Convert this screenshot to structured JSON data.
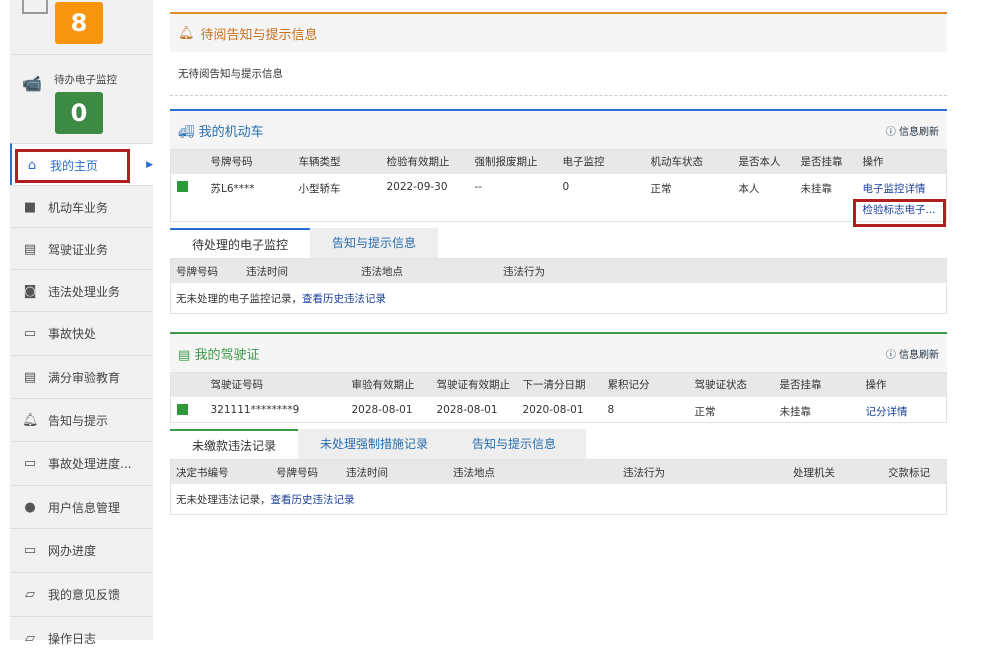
{
  "sidebar": {
    "pending_count": "8",
    "monitor_label": "待办电子监控",
    "monitor_count": "0",
    "items": [
      {
        "label": "我的主页",
        "icon": "home-icon"
      },
      {
        "label": "机动车业务",
        "icon": "truck-icon"
      },
      {
        "label": "驾驶证业务",
        "icon": "card-icon"
      },
      {
        "label": "违法处理业务",
        "icon": "camera-icon"
      },
      {
        "label": "事故快处",
        "icon": "car-icon"
      },
      {
        "label": "满分审验教育",
        "icon": "card-icon"
      },
      {
        "label": "告知与提示",
        "icon": "bell-icon"
      },
      {
        "label": "事故处理进度...",
        "icon": "car-icon"
      },
      {
        "label": "用户信息管理",
        "icon": "user-icon"
      },
      {
        "label": "网办进度",
        "icon": "car-icon"
      },
      {
        "label": "我的意见反馈",
        "icon": "feedback-icon"
      },
      {
        "label": "操作日志",
        "icon": "log-icon"
      }
    ]
  },
  "notice": {
    "title": "待阅告知与提示信息",
    "empty": "无待阅告知与提示信息"
  },
  "vehicle": {
    "title": "我的机动车",
    "refresh": "信息刷新",
    "headers": [
      "号牌号码",
      "车辆类型",
      "检验有效期止",
      "强制报废期止",
      "电子监控",
      "机动车状态",
      "是否本人",
      "是否挂靠",
      "操作"
    ],
    "row": [
      "苏L6****",
      "小型轿车",
      "2022-09-30",
      "--",
      "0",
      "正常",
      "本人",
      "未挂靠"
    ],
    "actions": [
      "电子监控详情",
      "检验标志电子..."
    ],
    "tabs": [
      "待处理的电子监控",
      "告知与提示信息"
    ],
    "sub_headers": [
      "号牌号码",
      "违法时间",
      "违法地点",
      "违法行为"
    ],
    "sub_msg": "无未处理的电子监控记录，",
    "sub_link": "查看历史违法记录"
  },
  "license": {
    "title": "我的驾驶证",
    "refresh": "信息刷新",
    "headers": [
      "驾驶证号码",
      "审验有效期止",
      "驾驶证有效期止",
      "下一清分日期",
      "累积记分",
      "驾驶证状态",
      "是否挂靠",
      "操作"
    ],
    "row": [
      "321111********9",
      "2028-08-01",
      "2028-08-01",
      "2020-08-01",
      "8",
      "正常",
      "未挂靠"
    ],
    "action": "记分详情",
    "tabs": [
      "未缴款违法记录",
      "未处理强制措施记录",
      "告知与提示信息"
    ],
    "sub_headers": [
      "决定书编号",
      "号牌号码",
      "违法时间",
      "违法地点",
      "违法行为",
      "处理机关",
      "交款标记"
    ],
    "sub_msg": "无未处理违法记录，",
    "sub_link": "查看历史违法记录"
  }
}
